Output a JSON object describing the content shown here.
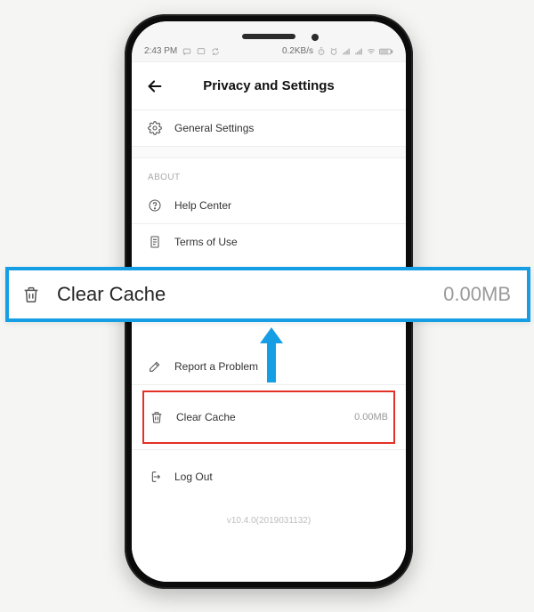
{
  "statusbar": {
    "time": "2:43 PM",
    "netspeed": "0.2KB/s"
  },
  "appbar": {
    "title": "Privacy and Settings"
  },
  "rows": {
    "general": {
      "label": "General Settings"
    },
    "about_header": "ABOUT",
    "help": {
      "label": "Help Center"
    },
    "terms": {
      "label": "Terms of Use"
    },
    "report": {
      "label": "Report a Problem"
    },
    "clear_cache": {
      "label": "Clear Cache",
      "value": "0.00MB"
    },
    "logout": {
      "label": "Log Out"
    }
  },
  "version": "v10.4.0(2019031132)",
  "callout": {
    "label": "Clear Cache",
    "value": "0.00MB"
  }
}
